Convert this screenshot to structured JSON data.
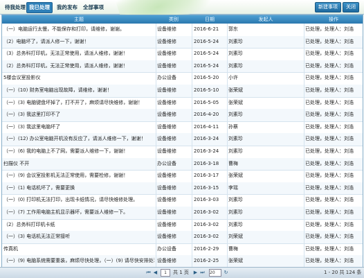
{
  "tabs": [
    {
      "label": "待我处理",
      "active": false
    },
    {
      "label": "我已处理",
      "active": true
    },
    {
      "label": "我的发布",
      "active": false
    },
    {
      "label": "全部事项",
      "active": false
    }
  ],
  "toolbar": {
    "new_label": "新建事项",
    "close_label": "关闭"
  },
  "columns": [
    "主题",
    "类别",
    "日期",
    "发起人",
    "操作"
  ],
  "rows": [
    {
      "subject": "（一）电脑运行太慢，不能保存和打印，请维修，谢谢。",
      "category": "设备维修",
      "date": "2016-6-21",
      "sender": "郭东",
      "action": "已处理，处理人：刘浩"
    },
    {
      "subject": "（2）电脑坏了，请派人修一下，谢谢！",
      "category": "设备维修",
      "date": "2016-5-24",
      "sender": "刘素珍",
      "action": "已处理，处理人：刘浩"
    },
    {
      "subject": "（3）总务科打印机，无法正常使用，请派人维修，谢谢！",
      "category": "设备维修",
      "date": "2016-5-24",
      "sender": "刘素珍",
      "action": "已处理，处理人：刘浩"
    },
    {
      "subject": "（2）总务科打印机，无法正常使用，请派人维修，谢谢！",
      "category": "设备维修",
      "date": "2016-5-24",
      "sender": "刘素珍",
      "action": "已处理，处理人：刘浩"
    },
    {
      "subject": "5楼会议室投影仪",
      "category": "办公设备",
      "date": "2016-5-20",
      "sender": "小许",
      "action": "已处理，处理人：刘浩"
    },
    {
      "subject": "（一）(10) 财务室电脑出现故障，请维修，谢谢！",
      "category": "设备维修",
      "date": "2016-5-10",
      "sender": "张荣斌",
      "action": "已处理，处理人：刘浩"
    },
    {
      "subject": "（一）(3) 电脑键盘坏掉了，打不开了，麻烦请尽快维修，谢谢！",
      "category": "设备维修",
      "date": "2016-5-05",
      "sender": "张荣斌",
      "action": "已处理，处理人：刘浩"
    },
    {
      "subject": "（一）(3) 我这里打印不了",
      "category": "设备维修",
      "date": "2016-4-20",
      "sender": "刘素珍",
      "action": "已处理，处理人：刘浩"
    },
    {
      "subject": "（一）(3) 我这里电脑坏了",
      "category": "设备维修",
      "date": "2016-4-11",
      "sender": "孙蔡",
      "action": "已处理，处理人：刘浩"
    },
    {
      "subject": "（一）(12) 办公室电脑开机没有反应了，请派人维修一下，谢谢！",
      "category": "设备维修",
      "date": "2016-3-24",
      "sender": "刘素珍",
      "action": "已处理，处理人：刘浩"
    },
    {
      "subject": "（一）(6) 我的电脑上不了网，需要派人维修一下，谢谢！",
      "category": "设备维修",
      "date": "2016-3-24",
      "sender": "刘素珍",
      "action": "已处理，处理人：刘浩"
    },
    {
      "subject": "扫描仪 不开",
      "category": "办公设备",
      "date": "2016-3-18",
      "sender": "曹梅",
      "action": "已处理，处理人：刘浩"
    },
    {
      "subject": "（一）(9) 会议室投影机无法正常使用，需要检修，谢谢！",
      "category": "设备维修",
      "date": "2016-3-17",
      "sender": "张荣斌",
      "action": "已处理，处理人：刘浩"
    },
    {
      "subject": "（一）(1) 电话机坏了，需要更换",
      "category": "设备维修",
      "date": "2016-3-15",
      "sender": "李瑶",
      "action": "已处理，处理人：刘浩"
    },
    {
      "subject": "（一）(0) 打印机无法打印，出现卡纸情况，请尽快维修处理。",
      "category": "设备维修",
      "date": "2016-3-03",
      "sender": "刘素珍",
      "action": "已处理，处理人：刘浩"
    },
    {
      "subject": "（一）(7) 工作用电脑主机显示器坏，需要派人维修一下。",
      "category": "设备维修",
      "date": "2016-3-02",
      "sender": "刘素珍",
      "action": "已处理，处理人：刘浩"
    },
    {
      "subject": "（2）总务科打印机卡纸",
      "category": "设备维修",
      "date": "2016-3-02",
      "sender": "刘素珍",
      "action": "已处理，处理人：刘浩"
    },
    {
      "subject": "（一）(3) 电话机无法正常接听",
      "category": "设备维修",
      "date": "2016-3-02",
      "sender": "刘荣斌",
      "action": "已处理，处理人：刘浩"
    },
    {
      "subject": "传真机",
      "category": "办公设备",
      "date": "2016-2-29",
      "sender": "曹梅",
      "action": "已处理，处理人：刘浩"
    },
    {
      "subject": "（一）(9) 电脑系统需要重装，麻烦尽快处理，（一）(9) 请尽快安排处理。",
      "category": "设备维修",
      "date": "2016-2-25",
      "sender": "张荣斌",
      "action": "已处理，处理人：刘浩"
    }
  ],
  "pager": {
    "page_label": "共 1 页",
    "page_value": "1",
    "page_size": "20",
    "summary": "1 - 20  共 124 条"
  }
}
